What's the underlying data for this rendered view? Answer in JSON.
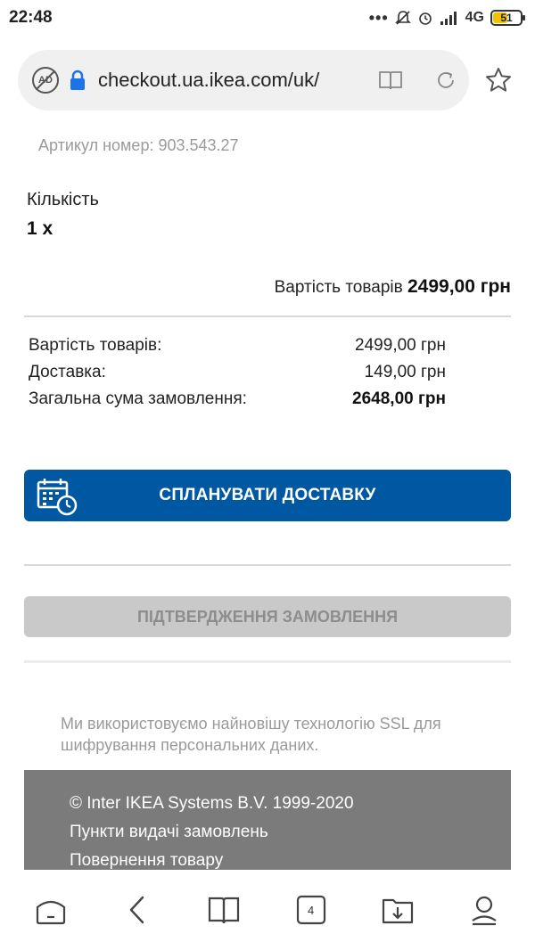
{
  "status_bar": {
    "time": "22:48",
    "dots": "•••",
    "network": "4G",
    "battery": "51"
  },
  "browser": {
    "url": "checkout.ua.ikea.com/uk/",
    "tab_count": "4"
  },
  "product": {
    "article_number": "Артикул номер: 903.543.27",
    "quantity_label": "Кількість",
    "quantity_value": "1 x",
    "goods_total_label": "Вартість товарів",
    "goods_total_value": "2499,00 грн"
  },
  "summary": {
    "rows": [
      {
        "label": "Вартість товарів:",
        "value": "2499,00 грн"
      },
      {
        "label": "Доставка:",
        "value": "149,00 грн"
      },
      {
        "label": "Загальна сума замовлення:",
        "value": "2648,00 грн"
      }
    ]
  },
  "actions": {
    "plan_delivery": "СПЛАНУВАТИ ДОСТАВКУ",
    "confirm_order": "ПІДТВЕРДЖЕННЯ ЗАМОВЛЕННЯ"
  },
  "ssl_note": "Ми використовуємо найновішу технологію SSL для шифрування персональних даних.",
  "footer": {
    "copyright": "© Inter IKEA Systems B.V. 1999-2020",
    "link_pickup": "Пункти видачі замовлень",
    "link_returns": "Повернення товару"
  },
  "colors": {
    "brand_blue": "#0058a3",
    "disabled_button": "#c9c9c9",
    "footer_gray": "#7b7b7b"
  },
  "icons": [
    "ad-block-icon",
    "lock-icon",
    "reader-mode-icon",
    "reload-icon",
    "star-icon",
    "calendar-clock-icon",
    "home-icon",
    "back-icon",
    "bookmarks-icon",
    "tabs-icon",
    "downloads-icon",
    "profile-icon"
  ]
}
